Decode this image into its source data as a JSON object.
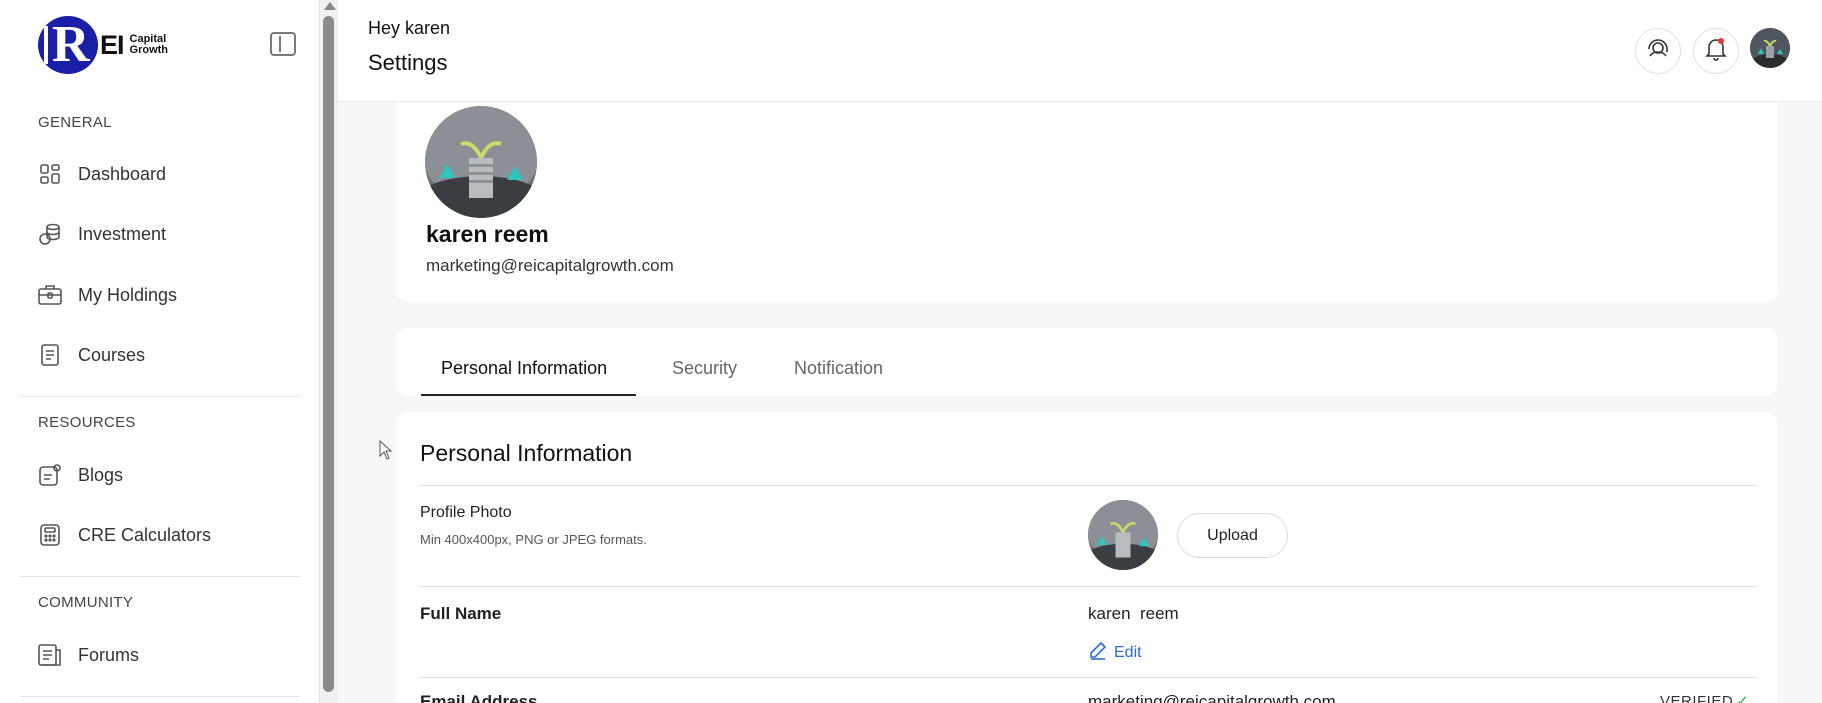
{
  "brand": {
    "logo_letters": "R",
    "logo_ei": "EI",
    "logo_line1": "Capital",
    "logo_line2": "Growth",
    "brand_color": "#1a1fa8"
  },
  "sidebar": {
    "sections": [
      {
        "title": "GENERAL"
      },
      {
        "title": "RESOURCES"
      },
      {
        "title": "COMMUNITY"
      }
    ],
    "items": [
      {
        "label": "Dashboard",
        "icon": "dashboard-grid-icon"
      },
      {
        "label": "Investment",
        "icon": "coins-icon"
      },
      {
        "label": "My Holdings",
        "icon": "briefcase-icon"
      },
      {
        "label": "Courses",
        "icon": "document-icon"
      },
      {
        "label": "Blogs",
        "icon": "blog-icon"
      },
      {
        "label": "CRE Calculators",
        "icon": "calculator-icon"
      },
      {
        "label": "Forums",
        "icon": "forum-icon"
      }
    ]
  },
  "header": {
    "greeting": "Hey karen",
    "title": "Settings"
  },
  "profile": {
    "name": "karen reem",
    "email": "marketing@reicapitalgrowth.com"
  },
  "tabs": [
    {
      "label": "Personal Information",
      "active": true
    },
    {
      "label": "Security",
      "active": false
    },
    {
      "label": "Notification",
      "active": false
    }
  ],
  "personal_info": {
    "heading": "Personal Information",
    "photo_label": "Profile Photo",
    "photo_hint": "Min 400x400px, PNG or JPEG formats.",
    "upload_label": "Upload",
    "fullname_label": "Full Name",
    "fullname_value": "karen  reem",
    "edit_label": "Edit",
    "email_label": "Email Address",
    "email_value": "marketing@reicapitalgrowth.com",
    "email_status": "VERIFIED"
  },
  "colors": {
    "accent_link": "#2a6cd6",
    "verified_green": "#2fa84f",
    "notification_dot": "#e53935"
  }
}
